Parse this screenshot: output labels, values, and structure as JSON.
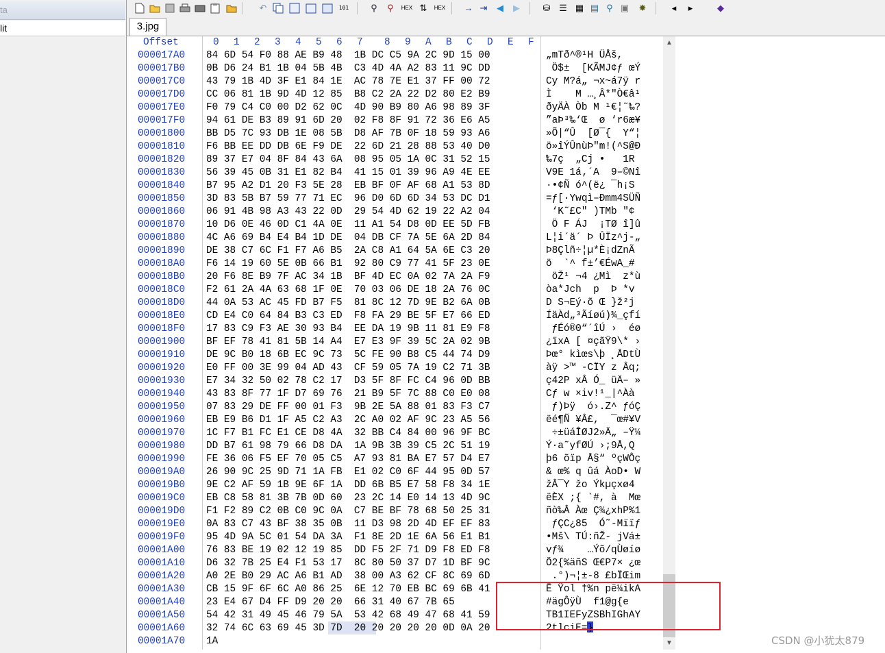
{
  "left_pane": {
    "row1": "ta",
    "row2": "lit"
  },
  "toolbar": {
    "icons": [
      "new-file-icon",
      "open-file-icon",
      "save-icon",
      "print-icon",
      "properties-icon",
      "clipboard-icon",
      "folder-icon",
      "undo-icon",
      "copy-icon",
      "cut-icon",
      "paste-icon",
      "paste-special-icon",
      "copy-hex-icon",
      "find-icon",
      "find-hex-icon",
      "replace-icon",
      "replace-hex-icon",
      "goto-icon",
      "jump-icon",
      "back-icon",
      "forward-icon",
      "disk-icon",
      "stack-icon",
      "ram-icon",
      "calc-icon",
      "search-icon",
      "camera-icon",
      "gear-icon",
      "prev-icon",
      "next-icon",
      "book-icon"
    ]
  },
  "tab": {
    "label": "3.jpg"
  },
  "header": {
    "offset_label": "Offset",
    "columns": [
      "0",
      "1",
      "2",
      "3",
      "4",
      "5",
      "6",
      "7",
      "8",
      "9",
      "A",
      "B",
      "C",
      "D",
      "E",
      "F"
    ]
  },
  "rows": [
    {
      "offset": "000017A0",
      "hex": "84 6D 54 F0 88 AE B9 48  1B DC C5 9A 2C 9D 15 00",
      "ascii": "„mTð^®¹H ÜÅš,"
    },
    {
      "offset": "000017B0",
      "hex": "0B D6 24 B1 1B 04 5B 4B  C3 4D 4A A2 83 11 9C DD",
      "ascii": " Ö$±  [KÃMJ¢ƒ œÝ"
    },
    {
      "offset": "000017C0",
      "hex": "43 79 1B 4D 3F E1 84 1E  AC 78 7E E1 37 FF 00 72",
      "ascii": "Cy M?á„ ¬x~á7ÿ r"
    },
    {
      "offset": "000017D0",
      "hex": "CC 06 81 1B 9D 4D 12 85  B8 C2 2A 22 D2 80 E2 B9",
      "ascii": "Ì    M …¸Â*\"Ò€â¹"
    },
    {
      "offset": "000017E0",
      "hex": "F0 79 C4 C0 00 D2 62 0C  4D 90 B9 80 A6 98 89 3F",
      "ascii": "ðyÄÀ Òb M ¹€¦˜‰?"
    },
    {
      "offset": "000017F0",
      "hex": "94 61 DE B3 89 91 6D 20  02 F8 8F 91 72 36 E6 A5",
      "ascii": "”aÞ³‰‘Œ  ø ‘r6æ¥"
    },
    {
      "offset": "00001800",
      "hex": "BB D5 7C 93 DB 1E 08 5B  D8 AF 7B 0F 18 59 93 A6",
      "ascii": "»Õ|“Û  [Ø¯{  Y“¦"
    },
    {
      "offset": "00001810",
      "hex": "F6 BB EE DD DB 6E F9 DE  22 6D 21 28 88 53 40 D0",
      "ascii": "ö»îÝÛnùÞ\"m!(^S@Ð"
    },
    {
      "offset": "00001820",
      "hex": "89 37 E7 04 8F 84 43 6A  08 95 05 1A 0C 31 52 15",
      "ascii": "‰7ç  „Cj •   1R"
    },
    {
      "offset": "00001830",
      "hex": "56 39 45 0B 31 E1 82 B4  41 15 01 39 96 A9 4E EE",
      "ascii": "V9E 1á‚´A  9–©Nî"
    },
    {
      "offset": "00001840",
      "hex": "B7 95 A2 D1 20 F3 5E 28  EB BF 0F AF 68 A1 53 8D",
      "ascii": "·•¢Ñ ó^(ë¿ ¯h¡S"
    },
    {
      "offset": "00001850",
      "hex": "3D 83 5B B7 59 77 71 EC  96 D0 6D 6D 34 53 DC D1",
      "ascii": "=ƒ[·Ywqì–Ðmm4SÜÑ"
    },
    {
      "offset": "00001860",
      "hex": "06 91 4B 98 A3 43 22 0D  29 54 4D 62 19 22 A2 04",
      "ascii": " ‘K˜£C\" )TMb \"¢"
    },
    {
      "offset": "00001870",
      "hex": "10 D6 0E 46 0D C1 4A 0E  11 A1 54 D8 0D EE 5D FB",
      "ascii": " Ö F ÁJ  ¡TØ î]û"
    },
    {
      "offset": "00001880",
      "hex": "4C A6 69 B4 E4 B4 1D DE  04 DB CF 7A 5E 6A 2D 84",
      "ascii": "L¦i´ä´ Þ ÛÏz^j-„"
    },
    {
      "offset": "00001890",
      "hex": "DE 38 C7 6C F1 F7 A6 B5  2A C8 A1 64 5A 6E C3 20",
      "ascii": "Þ8Çlñ÷¦µ*È¡dZnÃ "
    },
    {
      "offset": "000018A0",
      "hex": "F6 14 19 60 5E 0B 66 B1  92 80 C9 77 41 5F 23 0E",
      "ascii": "ö  `^ f±’€ÉwA_# "
    },
    {
      "offset": "000018B0",
      "hex": "20 F6 8E B9 7F AC 34 1B  BF 4D EC 0A 02 7A 2A F9",
      "ascii": " öŽ¹ ¬4 ¿Mì  z*ù"
    },
    {
      "offset": "000018C0",
      "hex": "F2 61 2A 4A 63 68 1F 0E  70 03 06 DE 18 2A 76 0C",
      "ascii": "òa*Jch  p  Þ *v "
    },
    {
      "offset": "000018D0",
      "hex": "44 0A 53 AC 45 FD B7 F5  81 8C 12 7D 9E B2 6A 0B",
      "ascii": "D S¬Eý·õ Œ }ž²j "
    },
    {
      "offset": "000018E0",
      "hex": "CD E4 C0 64 84 B3 C3 ED  F8 FA 29 BE 5F E7 66 ED",
      "ascii": "ÍäÀd„³Ãíøú)¾_çfí"
    },
    {
      "offset": "000018F0",
      "hex": "17 83 C9 F3 AE 30 93 B4  EE DA 19 9B 11 81 E9 F8",
      "ascii": " ƒÉó®0“´îÚ ›  éø"
    },
    {
      "offset": "00001900",
      "hex": "BF EF 78 41 81 5B 14 A4  E7 E3 9F 39 5C 2A 02 9B",
      "ascii": "¿ïxA [ ¤çãŸ9\\* ›"
    },
    {
      "offset": "00001910",
      "hex": "DE 9C B0 18 6B EC 9C 73  5C FE 90 B8 C5 44 74 D9",
      "ascii": "Þœ° kìœs\\þ ¸ÅDtÙ"
    },
    {
      "offset": "00001920",
      "hex": "E0 FF 00 3E 99 04 AD 43  CF 59 05 7A 19 C2 71 3B",
      "ascii": "àÿ >™ -CÏY z Âq;"
    },
    {
      "offset": "00001930",
      "hex": "E7 34 32 50 02 78 C2 17  D3 5F 8F FC C4 96 0D BB",
      "ascii": "ç42P xÂ Ó_ üÄ– »"
    },
    {
      "offset": "00001940",
      "hex": "43 83 8F 77 1F D7 69 76  21 B9 5F 7C 88 C0 E0 08",
      "ascii": "Cƒ w ×iv!¹_|^Àà "
    },
    {
      "offset": "00001950",
      "hex": "07 83 29 DE FF 00 01 F3  9B 2E 5A 88 01 83 F3 C7",
      "ascii": " ƒ)Þÿ  ó›.Z^ ƒóÇ"
    },
    {
      "offset": "00001960",
      "hex": "EB E9 B6 D1 1F A5 C2 A3  2C A0 02 AF 9C 23 A5 56",
      "ascii": "ëé¶Ñ ¥Â£,  ¯œ#¥V"
    },
    {
      "offset": "00001970",
      "hex": "1C F7 B1 FC E1 CE D8 4A  32 BB C4 84 00 96 9F BC",
      "ascii": " ÷±üáÎØJ2»Ä„ –Ÿ¼"
    },
    {
      "offset": "00001980",
      "hex": "DD B7 61 98 79 66 D8 DA  1A 9B 3B 39 C5 2C 51 19",
      "ascii": "Ý·a˜yfØÚ ›;9Å,Q "
    },
    {
      "offset": "00001990",
      "hex": "FE 36 06 F5 EF 70 05 C5  A7 93 81 BA E7 57 D4 E7",
      "ascii": "þ6 õïp Å§“ ºçWÔç"
    },
    {
      "offset": "000019A0",
      "hex": "26 90 9C 25 9D 71 1A FB  E1 02 C0 6F 44 95 0D 57",
      "ascii": "& œ% q ûá ÀoD• W"
    },
    {
      "offset": "000019B0",
      "hex": "9E C2 AF 59 1B 9E 6F 1A  DD 6B B5 E7 58 F8 34 1E",
      "ascii": "žÂ¯Y žo Ýkµçxø4 "
    },
    {
      "offset": "000019C0",
      "hex": "EB C8 58 81 3B 7B 0D 60  23 2C 14 E0 14 13 4D 9C",
      "ascii": "ëÈX ;{ `#, à  Mœ"
    },
    {
      "offset": "000019D0",
      "hex": "F1 F2 89 C2 0B C0 9C 0A  C7 BE BF 78 68 50 25 31",
      "ascii": "ñò‰Â Àœ Ç¾¿xhP%1"
    },
    {
      "offset": "000019E0",
      "hex": "0A 83 C7 43 BF 38 35 0B  11 D3 98 2D 4D EF EF 83",
      "ascii": " ƒÇC¿85  Ó˜-Mïïƒ"
    },
    {
      "offset": "000019F0",
      "hex": "95 4D 9A 5C 01 54 DA 3A  F1 8E 2D 1E 6A 56 E1 B1",
      "ascii": "•Mš\\ TÚ:ñŽ- jVá±"
    },
    {
      "offset": "00001A00",
      "hex": "76 83 BE 19 02 12 19 85  DD F5 2F 71 D9 F8 ED F8",
      "ascii": "vƒ¾    …Ýõ/qÙøíø"
    },
    {
      "offset": "00001A10",
      "hex": "D6 32 7B 25 E4 F1 53 17  8C 80 50 37 D7 1D BF 9C",
      "ascii": "Ö2{%äñS Œ€P7× ¿œ"
    },
    {
      "offset": "00001A20",
      "hex": "A0 2E B0 29 AC A6 B1 AD  38 00 A3 62 CF 8C 69 6D",
      "ascii": " .°)¬¦±-8 £bÏŒim"
    },
    {
      "offset": "00001A30",
      "hex": "CB 15 9F 6F 6C A0 86 25  6E 12 70 EB BC 69 6B 41",
      "ascii": "Ë Ÿol †%n pë¼ikA"
    },
    {
      "offset": "00001A40",
      "hex": "23 E4 67 D4 FF D9 20 20  66 31 40 67 7B 65",
      "ascii": "#ägÔÿÙ  f1@g{e"
    },
    {
      "offset": "00001A50",
      "hex": "54 42 31 49 45 46 79 5A  53 42 68 49 47 68 41 59",
      "ascii": "TB1IEFyZSBhIGhAY"
    },
    {
      "offset": "00001A60",
      "hex": "32 74 6C 63 69 45 3D 7D  20 20 20 20 20 0D 0A 20",
      "ascii": "2tlciE=}"
    },
    {
      "offset": "00001A70",
      "hex": "1A",
      "ascii": ""
    }
  ],
  "watermark": "CSDN @小犹太879"
}
